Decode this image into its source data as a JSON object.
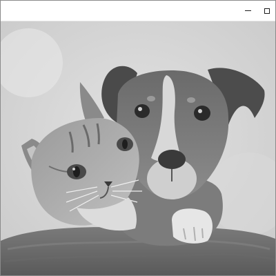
{
  "window": {
    "title": "",
    "controls": [
      "minimize",
      "maximize"
    ]
  },
  "viewer": {
    "image_subject": "photo-cat-and-dog",
    "mode": "grayscale"
  }
}
